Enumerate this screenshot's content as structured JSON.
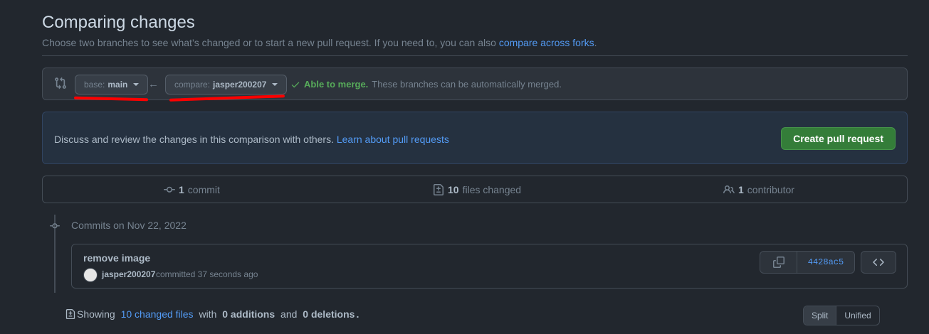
{
  "header": {
    "title": "Comparing changes",
    "subtitle": "Choose two branches to see what’s changed or to start a new pull request. If you need to, you can also",
    "subtitle_link": "compare across forks",
    "subtitle_end": "."
  },
  "range": {
    "base_key": "base:",
    "base_value": "main",
    "compare_key": "compare:",
    "compare_value": "jasper200207",
    "arrow": "←",
    "merge_status": "Able to merge.",
    "merge_desc": "These branches can be automatically merged."
  },
  "flash": {
    "text": "Discuss and review the changes in this comparison with others.",
    "link": "Learn about pull requests",
    "button": "Create pull request"
  },
  "summary": {
    "commits_count": "1",
    "commits_label": "commit",
    "files_count": "10",
    "files_label": "files changed",
    "contributors_count": "1",
    "contributors_label": "contributor"
  },
  "commits": {
    "date_heading": "Commits on Nov 22, 2022",
    "items": [
      {
        "message": "remove image",
        "author": "jasper200207",
        "meta": "committed 37 seconds ago",
        "sha": "4428ac5"
      }
    ]
  },
  "diff_stats": {
    "showing": "Showing",
    "changed_files": "10 changed files",
    "with": "with",
    "additions": "0 additions",
    "and": "and",
    "deletions": "0 deletions",
    "period": ".",
    "split": "Split",
    "unified": "Unified"
  },
  "colors": {
    "background": "#22272e",
    "link": "#539bf5",
    "success": "#57ab5a",
    "primary_button": "#347d39",
    "annotation": "#ff0000"
  }
}
